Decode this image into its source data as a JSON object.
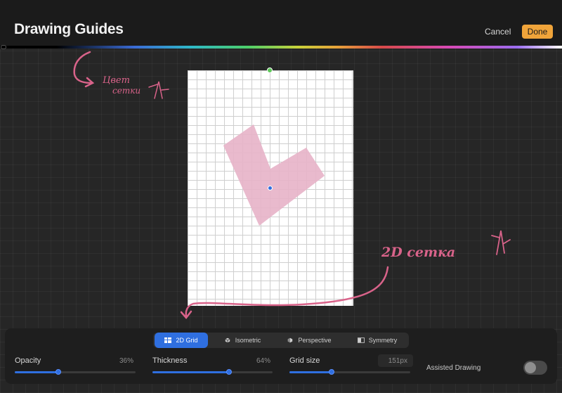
{
  "header": {
    "title": "Drawing Guides",
    "cancel_label": "Cancel",
    "done_label": "Done"
  },
  "annotations": {
    "color_note_line1": "Цвет",
    "color_note_line2": "сетки",
    "grid_note": "2D сетка"
  },
  "tabs": [
    {
      "label": "2D Grid",
      "icon": "grid-icon",
      "active": true
    },
    {
      "label": "Isometric",
      "icon": "isometric-icon",
      "active": false
    },
    {
      "label": "Perspective",
      "icon": "perspective-icon",
      "active": false
    },
    {
      "label": "Symmetry",
      "icon": "symmetry-icon",
      "active": false
    }
  ],
  "controls": {
    "opacity": {
      "label": "Opacity",
      "value": "36%",
      "level": 0.36
    },
    "thickness": {
      "label": "Thickness",
      "value": "64%",
      "level": 0.64
    },
    "grid_size": {
      "label": "Grid size",
      "value": "151px",
      "level": 0.35
    },
    "assisted_drawing": {
      "label": "Assisted Drawing",
      "on": false
    }
  },
  "colors": {
    "accent": "#2f6fe0",
    "done": "#f0a43a",
    "shape_fill": "#e7b3c8",
    "annotation": "#d9638a"
  }
}
